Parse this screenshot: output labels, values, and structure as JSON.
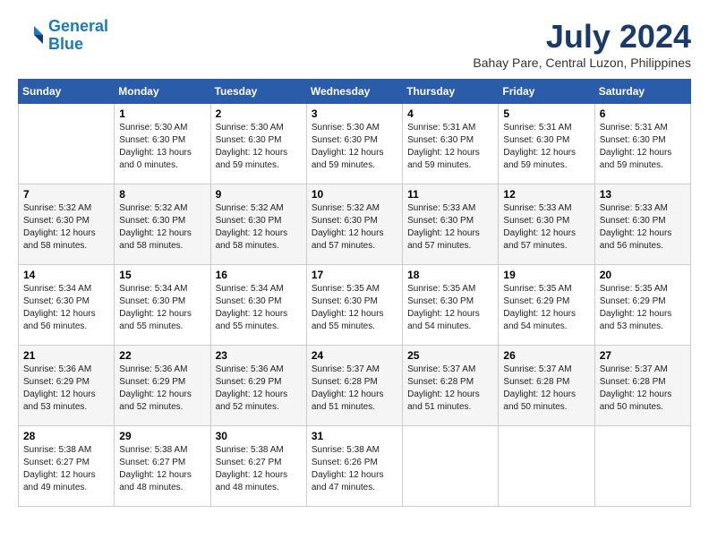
{
  "header": {
    "logo_line1": "General",
    "logo_line2": "Blue",
    "month": "July 2024",
    "location": "Bahay Pare, Central Luzon, Philippines"
  },
  "weekdays": [
    "Sunday",
    "Monday",
    "Tuesday",
    "Wednesday",
    "Thursday",
    "Friday",
    "Saturday"
  ],
  "weeks": [
    [
      {
        "day": "",
        "info": ""
      },
      {
        "day": "1",
        "info": "Sunrise: 5:30 AM\nSunset: 6:30 PM\nDaylight: 13 hours\nand 0 minutes."
      },
      {
        "day": "2",
        "info": "Sunrise: 5:30 AM\nSunset: 6:30 PM\nDaylight: 12 hours\nand 59 minutes."
      },
      {
        "day": "3",
        "info": "Sunrise: 5:30 AM\nSunset: 6:30 PM\nDaylight: 12 hours\nand 59 minutes."
      },
      {
        "day": "4",
        "info": "Sunrise: 5:31 AM\nSunset: 6:30 PM\nDaylight: 12 hours\nand 59 minutes."
      },
      {
        "day": "5",
        "info": "Sunrise: 5:31 AM\nSunset: 6:30 PM\nDaylight: 12 hours\nand 59 minutes."
      },
      {
        "day": "6",
        "info": "Sunrise: 5:31 AM\nSunset: 6:30 PM\nDaylight: 12 hours\nand 59 minutes."
      }
    ],
    [
      {
        "day": "7",
        "info": "Sunrise: 5:32 AM\nSunset: 6:30 PM\nDaylight: 12 hours\nand 58 minutes."
      },
      {
        "day": "8",
        "info": "Sunrise: 5:32 AM\nSunset: 6:30 PM\nDaylight: 12 hours\nand 58 minutes."
      },
      {
        "day": "9",
        "info": "Sunrise: 5:32 AM\nSunset: 6:30 PM\nDaylight: 12 hours\nand 58 minutes."
      },
      {
        "day": "10",
        "info": "Sunrise: 5:32 AM\nSunset: 6:30 PM\nDaylight: 12 hours\nand 57 minutes."
      },
      {
        "day": "11",
        "info": "Sunrise: 5:33 AM\nSunset: 6:30 PM\nDaylight: 12 hours\nand 57 minutes."
      },
      {
        "day": "12",
        "info": "Sunrise: 5:33 AM\nSunset: 6:30 PM\nDaylight: 12 hours\nand 57 minutes."
      },
      {
        "day": "13",
        "info": "Sunrise: 5:33 AM\nSunset: 6:30 PM\nDaylight: 12 hours\nand 56 minutes."
      }
    ],
    [
      {
        "day": "14",
        "info": "Sunrise: 5:34 AM\nSunset: 6:30 PM\nDaylight: 12 hours\nand 56 minutes."
      },
      {
        "day": "15",
        "info": "Sunrise: 5:34 AM\nSunset: 6:30 PM\nDaylight: 12 hours\nand 55 minutes."
      },
      {
        "day": "16",
        "info": "Sunrise: 5:34 AM\nSunset: 6:30 PM\nDaylight: 12 hours\nand 55 minutes."
      },
      {
        "day": "17",
        "info": "Sunrise: 5:35 AM\nSunset: 6:30 PM\nDaylight: 12 hours\nand 55 minutes."
      },
      {
        "day": "18",
        "info": "Sunrise: 5:35 AM\nSunset: 6:30 PM\nDaylight: 12 hours\nand 54 minutes."
      },
      {
        "day": "19",
        "info": "Sunrise: 5:35 AM\nSunset: 6:29 PM\nDaylight: 12 hours\nand 54 minutes."
      },
      {
        "day": "20",
        "info": "Sunrise: 5:35 AM\nSunset: 6:29 PM\nDaylight: 12 hours\nand 53 minutes."
      }
    ],
    [
      {
        "day": "21",
        "info": "Sunrise: 5:36 AM\nSunset: 6:29 PM\nDaylight: 12 hours\nand 53 minutes."
      },
      {
        "day": "22",
        "info": "Sunrise: 5:36 AM\nSunset: 6:29 PM\nDaylight: 12 hours\nand 52 minutes."
      },
      {
        "day": "23",
        "info": "Sunrise: 5:36 AM\nSunset: 6:29 PM\nDaylight: 12 hours\nand 52 minutes."
      },
      {
        "day": "24",
        "info": "Sunrise: 5:37 AM\nSunset: 6:28 PM\nDaylight: 12 hours\nand 51 minutes."
      },
      {
        "day": "25",
        "info": "Sunrise: 5:37 AM\nSunset: 6:28 PM\nDaylight: 12 hours\nand 51 minutes."
      },
      {
        "day": "26",
        "info": "Sunrise: 5:37 AM\nSunset: 6:28 PM\nDaylight: 12 hours\nand 50 minutes."
      },
      {
        "day": "27",
        "info": "Sunrise: 5:37 AM\nSunset: 6:28 PM\nDaylight: 12 hours\nand 50 minutes."
      }
    ],
    [
      {
        "day": "28",
        "info": "Sunrise: 5:38 AM\nSunset: 6:27 PM\nDaylight: 12 hours\nand 49 minutes."
      },
      {
        "day": "29",
        "info": "Sunrise: 5:38 AM\nSunset: 6:27 PM\nDaylight: 12 hours\nand 48 minutes."
      },
      {
        "day": "30",
        "info": "Sunrise: 5:38 AM\nSunset: 6:27 PM\nDaylight: 12 hours\nand 48 minutes."
      },
      {
        "day": "31",
        "info": "Sunrise: 5:38 AM\nSunset: 6:26 PM\nDaylight: 12 hours\nand 47 minutes."
      },
      {
        "day": "",
        "info": ""
      },
      {
        "day": "",
        "info": ""
      },
      {
        "day": "",
        "info": ""
      }
    ]
  ]
}
